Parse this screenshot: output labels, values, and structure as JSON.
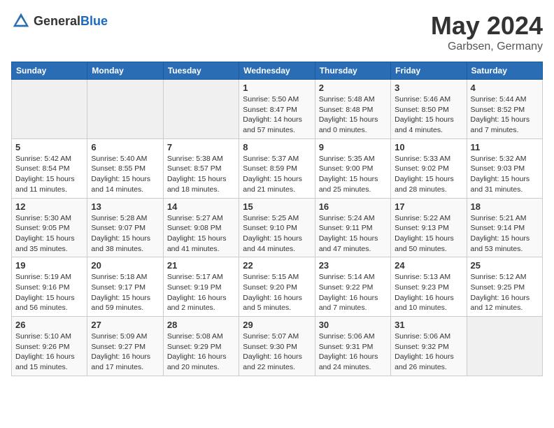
{
  "logo": {
    "text_general": "General",
    "text_blue": "Blue"
  },
  "title": {
    "month": "May 2024",
    "location": "Garbsen, Germany"
  },
  "days_of_week": [
    "Sunday",
    "Monday",
    "Tuesday",
    "Wednesday",
    "Thursday",
    "Friday",
    "Saturday"
  ],
  "weeks": [
    {
      "days": [
        {
          "num": "",
          "detail": ""
        },
        {
          "num": "",
          "detail": ""
        },
        {
          "num": "",
          "detail": ""
        },
        {
          "num": "1",
          "detail": "Sunrise: 5:50 AM\nSunset: 8:47 PM\nDaylight: 14 hours\nand 57 minutes."
        },
        {
          "num": "2",
          "detail": "Sunrise: 5:48 AM\nSunset: 8:48 PM\nDaylight: 15 hours\nand 0 minutes."
        },
        {
          "num": "3",
          "detail": "Sunrise: 5:46 AM\nSunset: 8:50 PM\nDaylight: 15 hours\nand 4 minutes."
        },
        {
          "num": "4",
          "detail": "Sunrise: 5:44 AM\nSunset: 8:52 PM\nDaylight: 15 hours\nand 7 minutes."
        }
      ]
    },
    {
      "days": [
        {
          "num": "5",
          "detail": "Sunrise: 5:42 AM\nSunset: 8:54 PM\nDaylight: 15 hours\nand 11 minutes."
        },
        {
          "num": "6",
          "detail": "Sunrise: 5:40 AM\nSunset: 8:55 PM\nDaylight: 15 hours\nand 14 minutes."
        },
        {
          "num": "7",
          "detail": "Sunrise: 5:38 AM\nSunset: 8:57 PM\nDaylight: 15 hours\nand 18 minutes."
        },
        {
          "num": "8",
          "detail": "Sunrise: 5:37 AM\nSunset: 8:59 PM\nDaylight: 15 hours\nand 21 minutes."
        },
        {
          "num": "9",
          "detail": "Sunrise: 5:35 AM\nSunset: 9:00 PM\nDaylight: 15 hours\nand 25 minutes."
        },
        {
          "num": "10",
          "detail": "Sunrise: 5:33 AM\nSunset: 9:02 PM\nDaylight: 15 hours\nand 28 minutes."
        },
        {
          "num": "11",
          "detail": "Sunrise: 5:32 AM\nSunset: 9:03 PM\nDaylight: 15 hours\nand 31 minutes."
        }
      ]
    },
    {
      "days": [
        {
          "num": "12",
          "detail": "Sunrise: 5:30 AM\nSunset: 9:05 PM\nDaylight: 15 hours\nand 35 minutes."
        },
        {
          "num": "13",
          "detail": "Sunrise: 5:28 AM\nSunset: 9:07 PM\nDaylight: 15 hours\nand 38 minutes."
        },
        {
          "num": "14",
          "detail": "Sunrise: 5:27 AM\nSunset: 9:08 PM\nDaylight: 15 hours\nand 41 minutes."
        },
        {
          "num": "15",
          "detail": "Sunrise: 5:25 AM\nSunset: 9:10 PM\nDaylight: 15 hours\nand 44 minutes."
        },
        {
          "num": "16",
          "detail": "Sunrise: 5:24 AM\nSunset: 9:11 PM\nDaylight: 15 hours\nand 47 minutes."
        },
        {
          "num": "17",
          "detail": "Sunrise: 5:22 AM\nSunset: 9:13 PM\nDaylight: 15 hours\nand 50 minutes."
        },
        {
          "num": "18",
          "detail": "Sunrise: 5:21 AM\nSunset: 9:14 PM\nDaylight: 15 hours\nand 53 minutes."
        }
      ]
    },
    {
      "days": [
        {
          "num": "19",
          "detail": "Sunrise: 5:19 AM\nSunset: 9:16 PM\nDaylight: 15 hours\nand 56 minutes."
        },
        {
          "num": "20",
          "detail": "Sunrise: 5:18 AM\nSunset: 9:17 PM\nDaylight: 15 hours\nand 59 minutes."
        },
        {
          "num": "21",
          "detail": "Sunrise: 5:17 AM\nSunset: 9:19 PM\nDaylight: 16 hours\nand 2 minutes."
        },
        {
          "num": "22",
          "detail": "Sunrise: 5:15 AM\nSunset: 9:20 PM\nDaylight: 16 hours\nand 5 minutes."
        },
        {
          "num": "23",
          "detail": "Sunrise: 5:14 AM\nSunset: 9:22 PM\nDaylight: 16 hours\nand 7 minutes."
        },
        {
          "num": "24",
          "detail": "Sunrise: 5:13 AM\nSunset: 9:23 PM\nDaylight: 16 hours\nand 10 minutes."
        },
        {
          "num": "25",
          "detail": "Sunrise: 5:12 AM\nSunset: 9:25 PM\nDaylight: 16 hours\nand 12 minutes."
        }
      ]
    },
    {
      "days": [
        {
          "num": "26",
          "detail": "Sunrise: 5:10 AM\nSunset: 9:26 PM\nDaylight: 16 hours\nand 15 minutes."
        },
        {
          "num": "27",
          "detail": "Sunrise: 5:09 AM\nSunset: 9:27 PM\nDaylight: 16 hours\nand 17 minutes."
        },
        {
          "num": "28",
          "detail": "Sunrise: 5:08 AM\nSunset: 9:29 PM\nDaylight: 16 hours\nand 20 minutes."
        },
        {
          "num": "29",
          "detail": "Sunrise: 5:07 AM\nSunset: 9:30 PM\nDaylight: 16 hours\nand 22 minutes."
        },
        {
          "num": "30",
          "detail": "Sunrise: 5:06 AM\nSunset: 9:31 PM\nDaylight: 16 hours\nand 24 minutes."
        },
        {
          "num": "31",
          "detail": "Sunrise: 5:06 AM\nSunset: 9:32 PM\nDaylight: 16 hours\nand 26 minutes."
        },
        {
          "num": "",
          "detail": ""
        }
      ]
    }
  ]
}
